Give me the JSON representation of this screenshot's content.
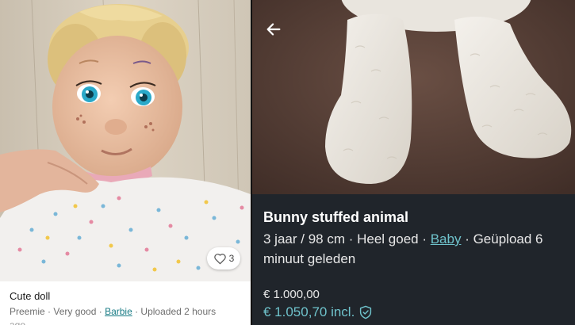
{
  "left_listing": {
    "title": "Cute doll",
    "condition": "Preemie · Very good · ",
    "brand": "Barbie",
    "uploaded": " · Uploaded 2 hours",
    "uploaded_cont": "ago",
    "favorites_count": "3",
    "favorite_icon": "heart-outline-icon",
    "photo_subject": "vintage baby doll with blue eyes"
  },
  "right_listing": {
    "back_icon": "arrow-left-icon",
    "photo_subject": "white plush bunny legs",
    "title": "Bunny stuffed animal",
    "meta_prefix": "3 jaar / 98 cm · Heel goed · ",
    "brand": "Baby",
    "meta_suffix": " · Geüpload 6",
    "meta_cont": "minuut geleden",
    "price": "€ 1.000,00",
    "price_incl": "€ 1.050,70 incl.",
    "protection_icon": "shield-check-icon"
  },
  "colors": {
    "accent_teal_light": "#1a7c85",
    "accent_teal_dark": "#6fc3cc",
    "dark_background": "#20252b"
  }
}
